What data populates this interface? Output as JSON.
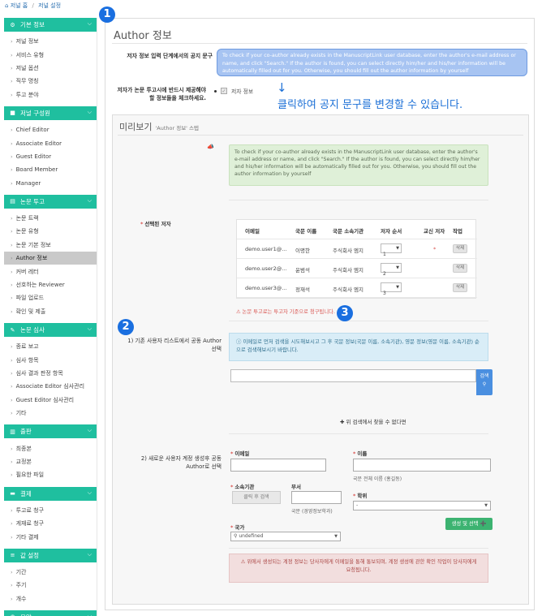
{
  "breadcrumb": {
    "home": "저널 홈",
    "current": "저널 설정"
  },
  "sidebar": {
    "sections": [
      {
        "title": "기본 정보",
        "icon": "gear-icon",
        "items": [
          "저널 정보",
          "서비스 유형",
          "저널 옵션",
          "직무 명칭",
          "투고 분야"
        ]
      },
      {
        "title": "저널 구성원",
        "icon": "briefcase-icon",
        "items": [
          "Chief Editor",
          "Associate Editor",
          "Guest Editor",
          "Board Member",
          "Manager"
        ]
      },
      {
        "title": "논문 투고",
        "icon": "file-icon",
        "items": [
          "논문 트랙",
          "논문 유형",
          "논문 기본 정보",
          "Author 정보",
          "커버 레터",
          "선호하는 Reviewer",
          "파일 업로드",
          "확인 및 제출"
        ]
      },
      {
        "title": "논문 심사",
        "icon": "edit-icon",
        "items": [
          "종료 보고",
          "심사 항목",
          "심사 결과 판정 항목",
          "Associate Editor 심사관리",
          "Guest Editor 심사관리",
          "기타"
        ]
      },
      {
        "title": "출판",
        "icon": "book-icon",
        "items": [
          "최종본",
          "교정본",
          "필요한 파일"
        ]
      },
      {
        "title": "결제",
        "icon": "card-icon",
        "items": [
          "투고료 청구",
          "게재료 청구",
          "기타 결제"
        ]
      },
      {
        "title": "값 설정",
        "icon": "sliders-icon",
        "items": [
          "기간",
          "주기",
          "개수"
        ]
      },
      {
        "title": "모양",
        "icon": "eye-icon",
        "items": []
      }
    ],
    "active_item": "Author 정보"
  },
  "page": {
    "title": "Author 정보",
    "notice_label": "저자 정보 입력 단계에서의 공지 문구",
    "notice_text": "To check if your co-author already exists in the ManuscriptLink user database, enter the author's e-mail address or name, and click \"Search.\" If the author is found, you can select directly him/her and his/her information will be automatically filled out for you. Otherwise, you should fill out the author information by yourself",
    "required_label": "저자가 논문 투고시에 반드시 제공해야 할 정보들을 체크하세요.",
    "required_option": "저자 정보",
    "annotation": "클릭하여  공지 문구를 변경할 수 있습니다.",
    "badges": [
      "1",
      "2",
      "3"
    ]
  },
  "preview": {
    "title": "미리보기",
    "subtitle": "'Author 정보' 스텝",
    "green_notice": "To check if your co-author already exists in the ManuscriptLink user database, enter the author's e-mail address or name, and click \"Search.\" If the author is found, you can select directly him/her and his/her information will be automatically filled out for you. Otherwise, you should fill out the author information by yourself",
    "selected_label": "선택된 저자",
    "table": {
      "headers": [
        "이메일",
        "국문 이름",
        "국문 소속기관",
        "저자 순서",
        "교신 저자",
        "작업"
      ],
      "rows": [
        {
          "email": "demo.user1@...",
          "name": "이명한",
          "org": "주식회사 엠지",
          "order": "1",
          "corr": "*",
          "action": "삭제"
        },
        {
          "email": "demo.user2@...",
          "name": "윤범석",
          "org": "주식회사 엠지",
          "order": "2",
          "corr": "",
          "action": "삭제"
        },
        {
          "email": "demo.user3@...",
          "name": "정재석",
          "org": "주식회사 엠지",
          "order": "3",
          "corr": "",
          "action": "삭제"
        }
      ]
    },
    "error": "논문 투고료는 투고자 기준으로 청구됩니다.",
    "search_section_label": "1) 기존 사용자 리스트에서 공동 Author 선택",
    "search_info": "이메일로 먼저 검색을 시도해보시고 그 후 국문 정보(국문 이름, 소속기관), 영문 정보(영문 이름, 소속기관) 순으로 검색해보시기 바랍니다.",
    "search_button": "검색",
    "not_found": "위 검색에서 찾을 수 없다면",
    "create_section_label": "2) 새로운 사용자 계정 생성후 공동 Author로 선택",
    "form": {
      "email_label": "이메일",
      "name_label": "이름",
      "name_help": "국문 전체 이름 (홍길동)",
      "org_label": "소속기관",
      "org_button": "클릭 후 검색",
      "dept_label": "부서",
      "dept_help": "국문 (경영정보학과)",
      "degree_label": "학위",
      "degree_value": "-",
      "country_label": "국가",
      "country_value": "undefined",
      "submit": "생성 및 선택"
    },
    "red_notice": "위에서 생성되는 계정 정보는 당사자에게 이메일을 통해 통보되며, 계정 생성에 관한 확인 작업이 당사자에게 요청됩니다."
  },
  "colors": {
    "accent": "#1fbf9f",
    "annotation": "#1b6fd6"
  }
}
